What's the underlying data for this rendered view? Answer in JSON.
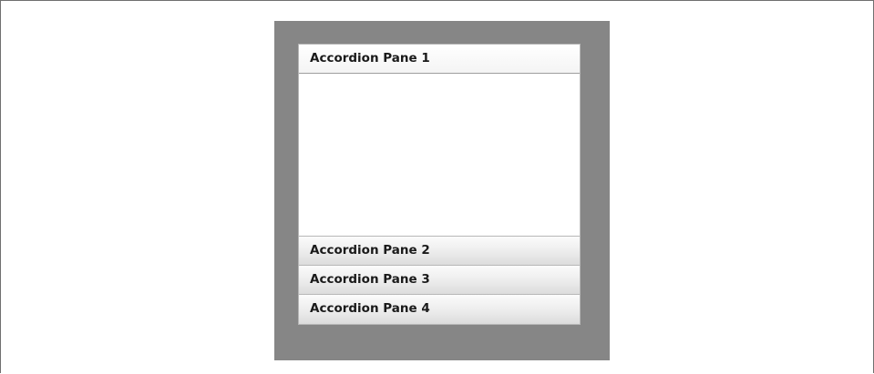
{
  "accordion": {
    "panes": [
      {
        "label": "Accordion Pane 1",
        "expanded": true
      },
      {
        "label": "Accordion Pane 2",
        "expanded": false
      },
      {
        "label": "Accordion Pane 3",
        "expanded": false
      },
      {
        "label": "Accordion Pane 4",
        "expanded": false
      }
    ]
  },
  "colors": {
    "panel_background": "#868686",
    "page_background": "#ffffff",
    "header_text": "#1a1a1a"
  }
}
